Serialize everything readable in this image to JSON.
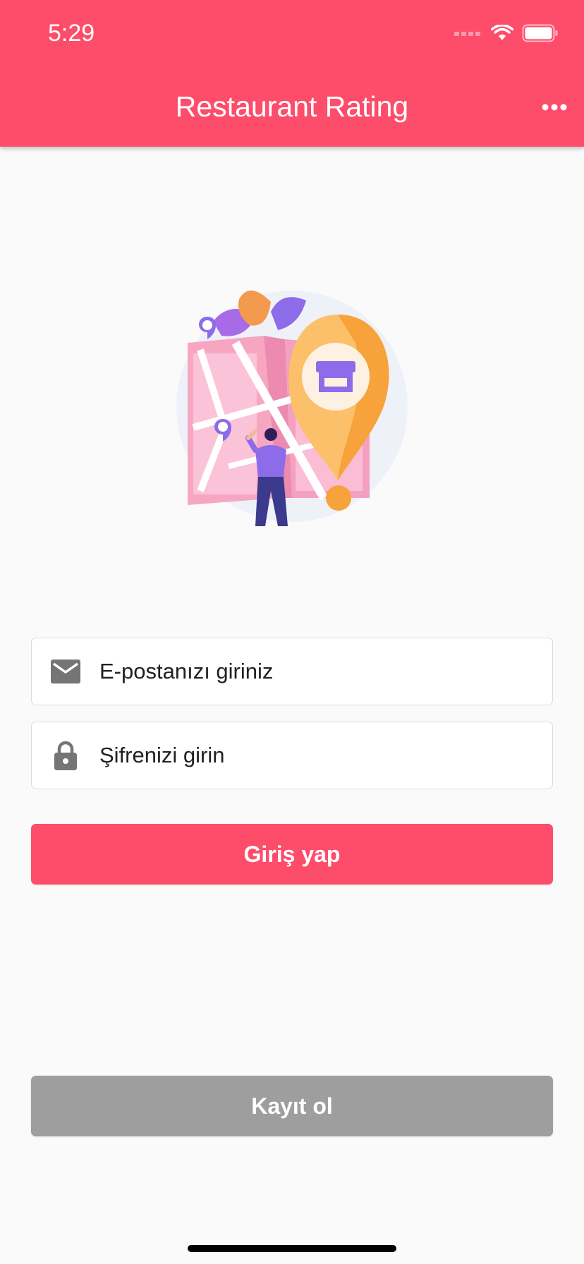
{
  "status_bar": {
    "time": "5:29",
    "icons": [
      "signal-icon",
      "wifi-icon",
      "battery-icon"
    ]
  },
  "app_bar": {
    "title": "Restaurant Rating",
    "menu_icon": "more-horiz-icon",
    "background_color": "#fe4c6b"
  },
  "illustration": {
    "description_icon": "restaurant-location-map-illustration"
  },
  "form": {
    "email": {
      "icon": "email-icon",
      "placeholder": "E-postanızı giriniz",
      "value": ""
    },
    "password": {
      "icon": "lock-icon",
      "placeholder": "Şifrenizi girin",
      "value": ""
    },
    "login_label": "Giriş yap",
    "register_label": "Kayıt ol"
  },
  "colors": {
    "accent": "#fe4c6b",
    "secondary_button": "#9e9e9e",
    "background": "#fafafa",
    "icon_gray": "#757575"
  }
}
